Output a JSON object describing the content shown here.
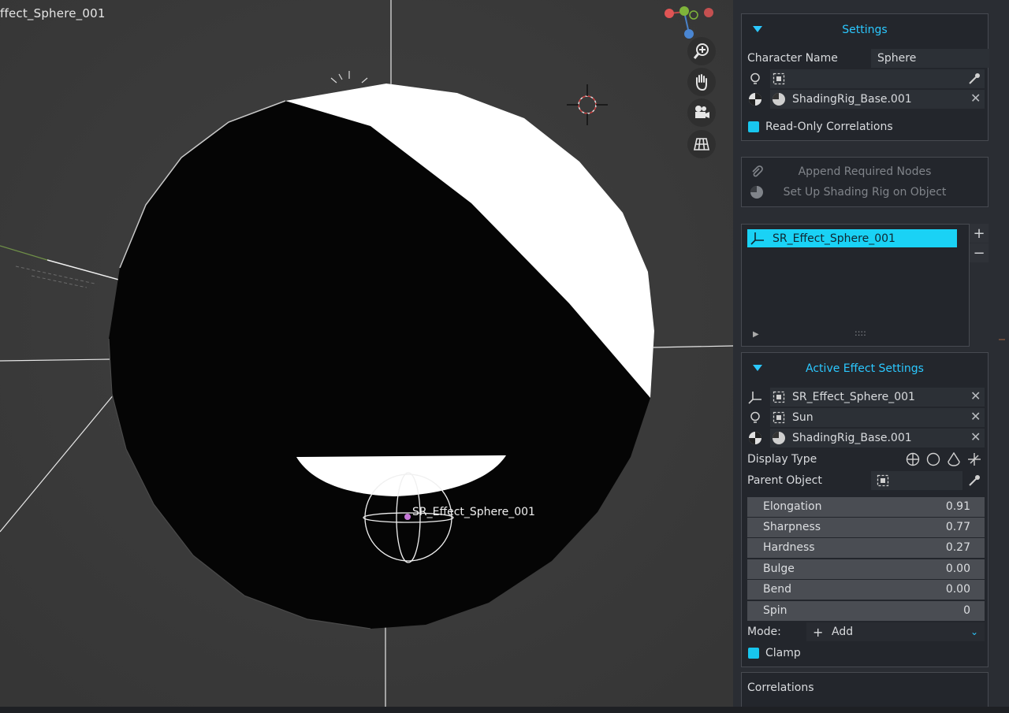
{
  "viewport": {
    "object_name": "ffect_Sphere_001",
    "empty_label": "SR_Effect_Sphere_001"
  },
  "settings": {
    "header": "Settings",
    "character_name_label": "Character Name",
    "character_name_value": "Sphere",
    "shading_rig_value": "ShadingRig_Base.001",
    "readonly_label": "Read-Only Correlations"
  },
  "actions": {
    "append_label": "Append Required Nodes",
    "setup_label": "Set Up Shading Rig on Object"
  },
  "effects_list": {
    "items": [
      "SR_Effect_Sphere_001"
    ],
    "add_symbol": "+",
    "remove_symbol": "−"
  },
  "active_effect": {
    "header": "Active Effect Settings",
    "effect_name": "SR_Effect_Sphere_001",
    "light_name": "Sun",
    "rig_name": "ShadingRig_Base.001",
    "display_type_label": "Display Type",
    "parent_object_label": "Parent Object",
    "sliders": [
      {
        "name": "Elongation",
        "value": "0.91"
      },
      {
        "name": "Sharpness",
        "value": "0.77"
      },
      {
        "name": "Hardness",
        "value": "0.27"
      },
      {
        "name": "Bulge",
        "value": "0.00"
      },
      {
        "name": "Bend",
        "value": "0.00"
      },
      {
        "name": "Spin",
        "value": "0"
      }
    ],
    "mode_label": "Mode:",
    "mode_value": "Add",
    "clamp_label": "Clamp"
  },
  "correlations": {
    "header": "Correlations"
  },
  "colors": {
    "accent": "#2bc8ff",
    "checkbox": "#18c6ee",
    "list_selected": "#1ad2f5"
  }
}
